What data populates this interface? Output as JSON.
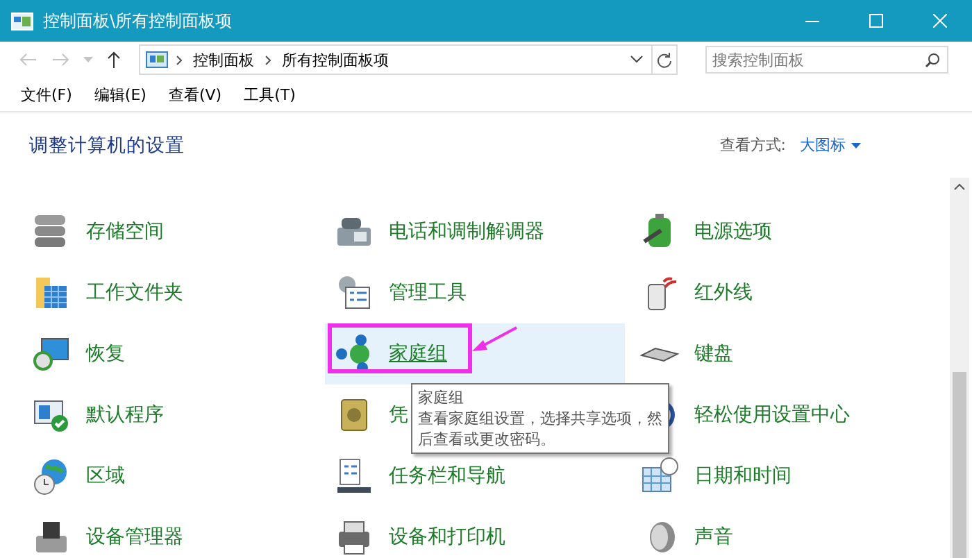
{
  "window": {
    "title": "控制面板\\所有控制面板项"
  },
  "address": {
    "path": [
      "控制面板",
      "所有控制面板项"
    ]
  },
  "search": {
    "placeholder": "搜索控制面板"
  },
  "menu": [
    "文件(F)",
    "编辑(E)",
    "查看(V)",
    "工具(T)"
  ],
  "heading": "调整计算机的设置",
  "view_by": {
    "label": "查看方式:",
    "value": "大图标"
  },
  "items": [
    {
      "label": "存储空间",
      "selected": false
    },
    {
      "label": "电话和调制解调器",
      "selected": false
    },
    {
      "label": "电源选项",
      "selected": false
    },
    {
      "label": "工作文件夹",
      "selected": false
    },
    {
      "label": "管理工具",
      "selected": false
    },
    {
      "label": "红外线",
      "selected": false
    },
    {
      "label": "恢复",
      "selected": false
    },
    {
      "label": "家庭组",
      "selected": true
    },
    {
      "label": "键盘",
      "selected": false
    },
    {
      "label": "默认程序",
      "selected": false
    },
    {
      "label": "凭",
      "selected": false
    },
    {
      "label": "轻松使用设置中心",
      "selected": false
    },
    {
      "label": "区域",
      "selected": false
    },
    {
      "label": "任务栏和导航",
      "selected": false
    },
    {
      "label": "日期和时间",
      "selected": false
    },
    {
      "label": "设备管理器",
      "selected": false
    },
    {
      "label": "设备和打印机",
      "selected": false
    },
    {
      "label": "声音",
      "selected": false
    }
  ],
  "tooltip": {
    "title": "家庭组",
    "text": "查看家庭组设置，选择共享选项，然后查看或更改密码。"
  }
}
